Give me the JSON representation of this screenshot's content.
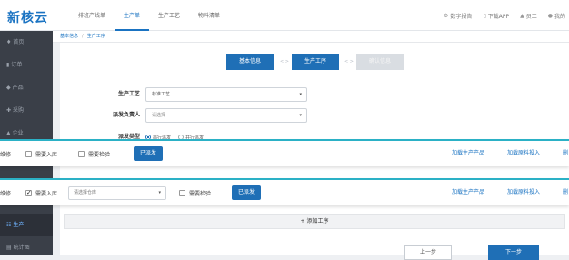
{
  "app": {
    "logo": "新核云"
  },
  "nav": {
    "items": [
      {
        "label": "排班产线单"
      },
      {
        "label": "生产单"
      },
      {
        "label": "生产工艺"
      },
      {
        "label": "物料清单"
      }
    ],
    "active_index": 1
  },
  "top_actions": [
    {
      "icon": "gear-icon",
      "label": "数字报告"
    },
    {
      "icon": "phone-icon",
      "label": "下载APP"
    },
    {
      "icon": "user-icon",
      "label": "员工"
    },
    {
      "icon": "user-circle-icon",
      "label": "我的"
    }
  ],
  "sidebar": {
    "items": [
      {
        "icon": "home-icon",
        "label": "首页"
      },
      {
        "icon": "order-icon",
        "label": "订单"
      },
      {
        "icon": "product-icon",
        "label": "产品"
      },
      {
        "icon": "purchase-icon",
        "label": "采购"
      },
      {
        "icon": "company-icon",
        "label": "企业"
      },
      {
        "icon": "production-icon",
        "label": "生产"
      },
      {
        "icon": "stats-icon",
        "label": "统计图"
      }
    ],
    "active_label": "生产"
  },
  "breadcrumb": {
    "home": "基本信息",
    "current": "生产工序"
  },
  "steps": [
    {
      "label": "基本信息",
      "state": "done"
    },
    {
      "label": "生产工序",
      "state": "active"
    },
    {
      "label": "确认信息",
      "state": "inactive"
    }
  ],
  "form": {
    "process": {
      "label": "生产工艺",
      "value": "标准工艺"
    },
    "owner": {
      "label": "派发负责人",
      "placeholder": "请选择"
    },
    "dispatch_type": {
      "label": "派发类型",
      "options": [
        {
          "label": "串行派发",
          "selected": true
        },
        {
          "label": "并行派发",
          "selected": false
        }
      ]
    }
  },
  "strip1": {
    "left_text": "维修",
    "need_storage": {
      "label": "需要入库",
      "checked": false
    },
    "need_inspection": {
      "label": "需要检验",
      "checked": false
    },
    "dispatch_button": "已派发",
    "link_products": "加载生产产品",
    "link_materials": "加载原料投入",
    "link_edge": "删"
  },
  "strip2": {
    "left_text": "维修",
    "need_storage": {
      "label": "需要入库",
      "checked": true
    },
    "warehouse_placeholder": "请选择仓库",
    "need_inspection": {
      "label": "需要检验",
      "checked": false
    },
    "dispatch_button": "已派发",
    "link_products": "加载生产产品",
    "link_materials": "加载原料投入",
    "link_edge": "删"
  },
  "add_step": {
    "label": "+ 添加工序"
  },
  "footer": {
    "prev_label": "上一步",
    "next_label": "下一步"
  },
  "colors": {
    "accent": "#1f6fb6",
    "strip_border": "#2bb1c6",
    "sidebar_bg": "#3a3f48"
  }
}
